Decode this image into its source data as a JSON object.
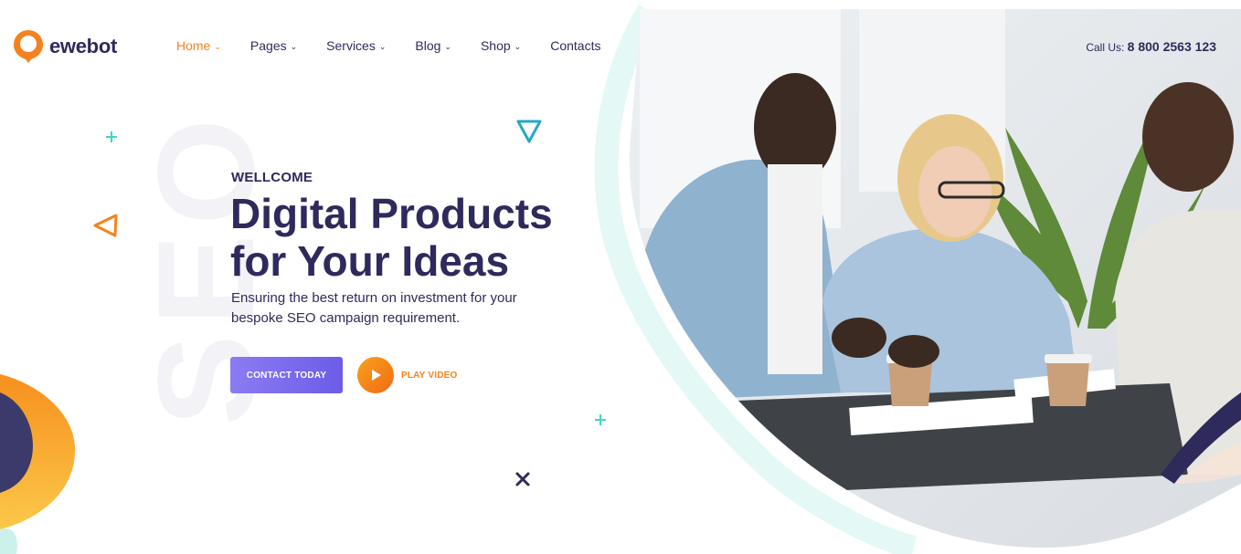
{
  "brand": {
    "name": "ewebot"
  },
  "nav": {
    "items": [
      {
        "label": "Home",
        "has_dropdown": true,
        "active": true
      },
      {
        "label": "Pages",
        "has_dropdown": true,
        "active": false
      },
      {
        "label": "Services",
        "has_dropdown": true,
        "active": false
      },
      {
        "label": "Blog",
        "has_dropdown": true,
        "active": false
      },
      {
        "label": "Shop",
        "has_dropdown": true,
        "active": false
      },
      {
        "label": "Contacts",
        "has_dropdown": false,
        "active": false
      }
    ]
  },
  "call": {
    "label": "Call Us:",
    "phone": "8 800 2563 123"
  },
  "hero": {
    "eyebrow": "WELLCOME",
    "title_line1": "Digital Products",
    "title_line2": "for Your Ideas",
    "subtitle": "Ensuring the best return on investment for your bespoke SEO campaign requirement.",
    "cta_primary": "CONTACT TODAY",
    "cta_video": "PLAY VIDEO",
    "watermark": "SEO"
  },
  "colors": {
    "accent": "#f5821f",
    "navy": "#2e2a5c",
    "purple": "#6c5ce7",
    "teal": "#3ed6c4"
  },
  "icons": [
    "logo-mark-icon",
    "chevron-down-icon",
    "play-icon",
    "triangle-decor-icon",
    "plus-decor-icon",
    "cross-decor-icon"
  ]
}
